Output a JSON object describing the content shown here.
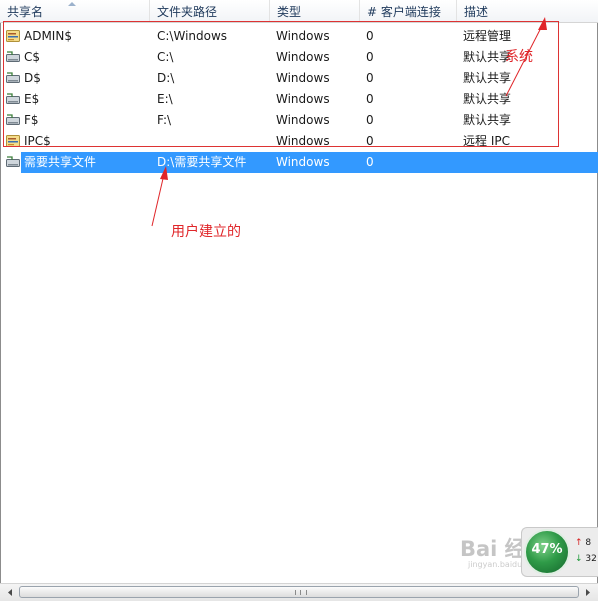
{
  "columns": [
    {
      "label": "共享名"
    },
    {
      "label": "文件夹路径"
    },
    {
      "label": "类型"
    },
    {
      "label": "# 客户端连接"
    },
    {
      "label": "描述"
    }
  ],
  "shares": [
    {
      "name": "ADMIN$",
      "path": "C:\\Windows",
      "type": "Windows",
      "clients": "0",
      "desc": "远程管理",
      "icon": "share-folder-icon"
    },
    {
      "name": "C$",
      "path": "C:\\",
      "type": "Windows",
      "clients": "0",
      "desc": "默认共享",
      "icon": "share-drive-icon"
    },
    {
      "name": "D$",
      "path": "D:\\",
      "type": "Windows",
      "clients": "0",
      "desc": "默认共享",
      "icon": "share-drive-icon"
    },
    {
      "name": "E$",
      "path": "E:\\",
      "type": "Windows",
      "clients": "0",
      "desc": "默认共享",
      "icon": "share-drive-icon"
    },
    {
      "name": "F$",
      "path": "F:\\",
      "type": "Windows",
      "clients": "0",
      "desc": "默认共享",
      "icon": "share-drive-icon"
    },
    {
      "name": "IPC$",
      "path": "",
      "type": "Windows",
      "clients": "0",
      "desc": "远程 IPC",
      "icon": "share-folder-icon"
    },
    {
      "name": "需要共享文件",
      "path": "D:\\需要共享文件",
      "type": "Windows",
      "clients": "0",
      "desc": "",
      "icon": "share-drive-icon",
      "selected": true
    }
  ],
  "annotations": {
    "system": "系统",
    "user_created": "用户建立的"
  },
  "widget": {
    "percent": "47%",
    "up_value": "8",
    "down_value": "32",
    "watermark": "Bai 经验",
    "watermark_sub": "jingyan.baidu.com"
  },
  "colors": {
    "selection": "#3399ff",
    "annotation": "#e0262a",
    "header_text": "#1e395b"
  }
}
